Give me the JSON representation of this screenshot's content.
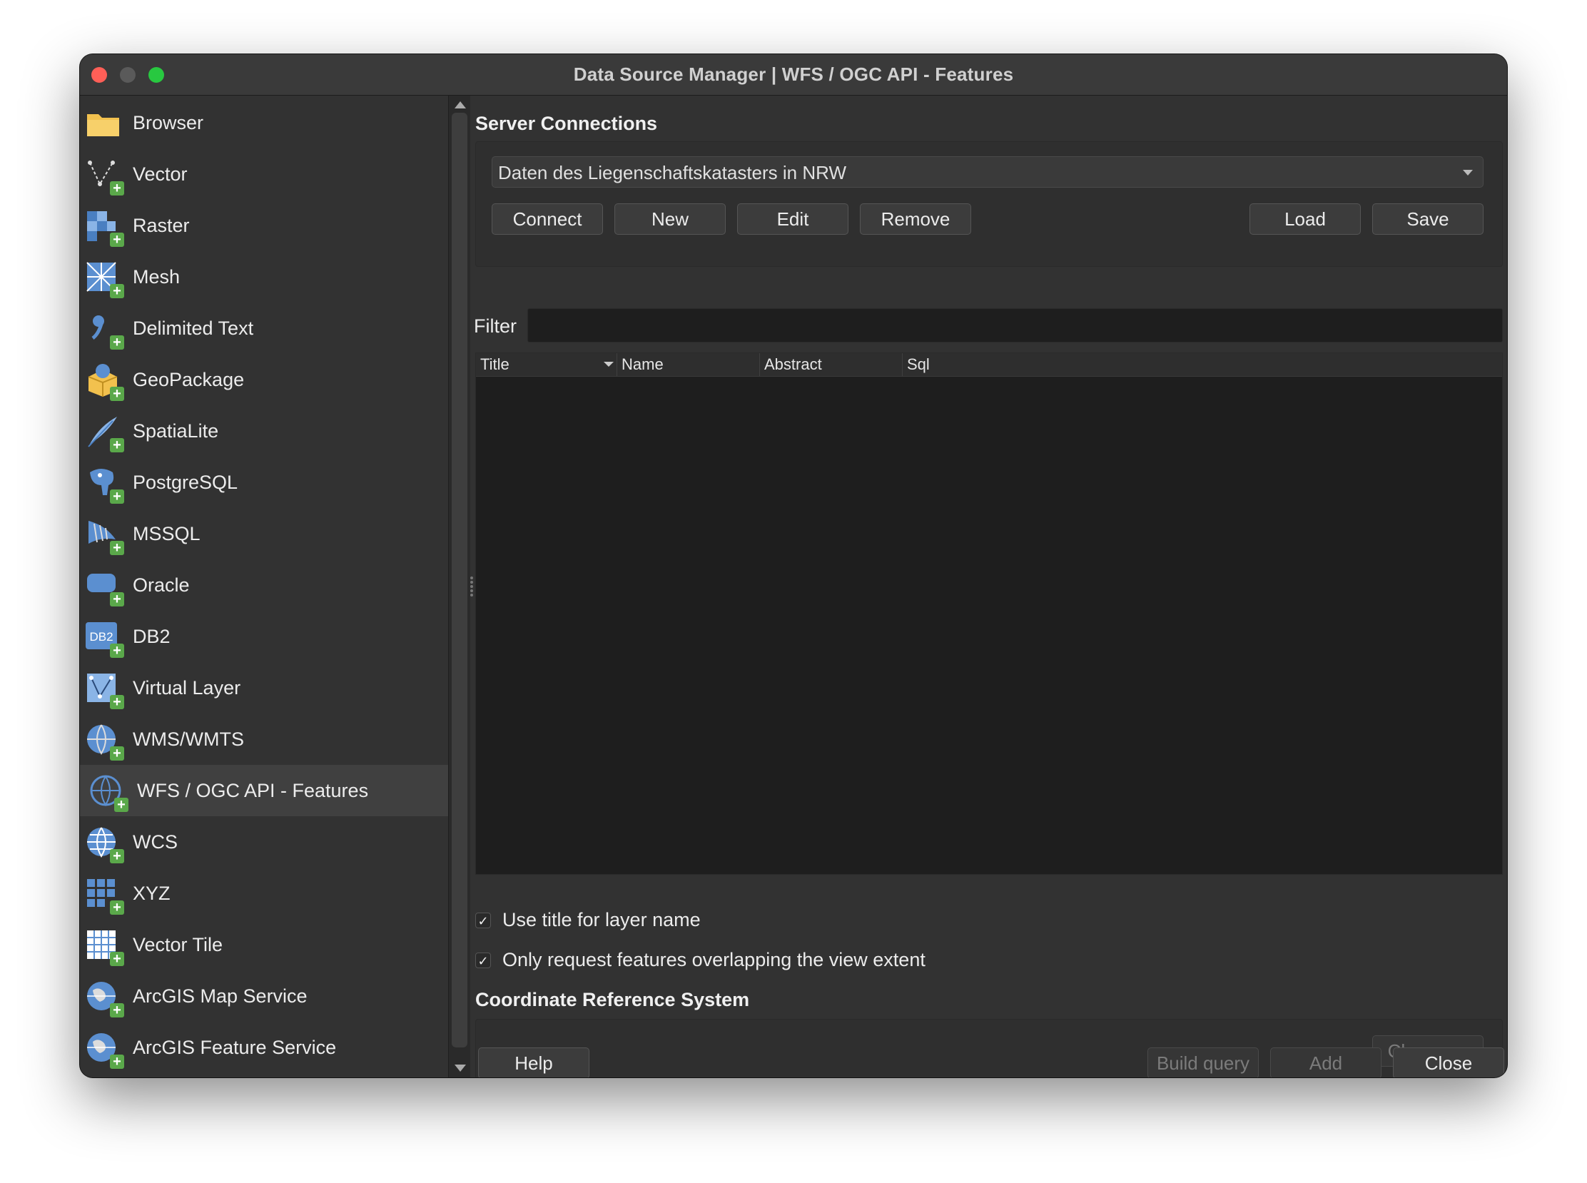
{
  "window": {
    "title": "Data Source Manager | WFS / OGC API - Features"
  },
  "sidebar": {
    "items": [
      {
        "label": "Browser",
        "icon": "folder-icon"
      },
      {
        "label": "Vector",
        "icon": "vector-icon"
      },
      {
        "label": "Raster",
        "icon": "raster-icon"
      },
      {
        "label": "Mesh",
        "icon": "mesh-icon"
      },
      {
        "label": "Delimited Text",
        "icon": "delimited-text-icon"
      },
      {
        "label": "GeoPackage",
        "icon": "geopackage-icon"
      },
      {
        "label": "SpatiaLite",
        "icon": "spatialite-icon"
      },
      {
        "label": "PostgreSQL",
        "icon": "postgresql-icon"
      },
      {
        "label": "MSSQL",
        "icon": "mssql-icon"
      },
      {
        "label": "Oracle",
        "icon": "oracle-icon"
      },
      {
        "label": "DB2",
        "icon": "db2-icon"
      },
      {
        "label": "Virtual Layer",
        "icon": "virtual-layer-icon"
      },
      {
        "label": "WMS/WMTS",
        "icon": "wms-icon"
      },
      {
        "label": "WFS / OGC API - Features",
        "icon": "wfs-icon"
      },
      {
        "label": "WCS",
        "icon": "wcs-icon"
      },
      {
        "label": "XYZ",
        "icon": "xyz-icon"
      },
      {
        "label": "Vector Tile",
        "icon": "vector-tile-icon"
      },
      {
        "label": "ArcGIS Map Service",
        "icon": "arcgis-map-icon"
      },
      {
        "label": "ArcGIS Feature Service",
        "icon": "arcgis-feature-icon"
      }
    ],
    "db2_icon_text": "DB2"
  },
  "server_connections": {
    "title": "Server Connections",
    "selected_connection": "Daten des Liegenschaftskatasters in NRW",
    "buttons": {
      "connect": "Connect",
      "new": "New",
      "edit": "Edit",
      "remove": "Remove",
      "load": "Load",
      "save": "Save"
    }
  },
  "filter": {
    "label": "Filter",
    "value": ""
  },
  "table": {
    "columns": [
      "Title",
      "Name",
      "Abstract",
      "Sql"
    ]
  },
  "options": {
    "use_title": {
      "label": "Use title for layer name",
      "checked": true
    },
    "only_request": {
      "label": "Only request features overlapping the view extent",
      "checked": true
    },
    "check_mark": "✓"
  },
  "crs": {
    "title": "Coordinate Reference System",
    "change_button": "Change..."
  },
  "footer": {
    "help": "Help",
    "build_query": "Build query",
    "add": "Add",
    "close": "Close"
  }
}
